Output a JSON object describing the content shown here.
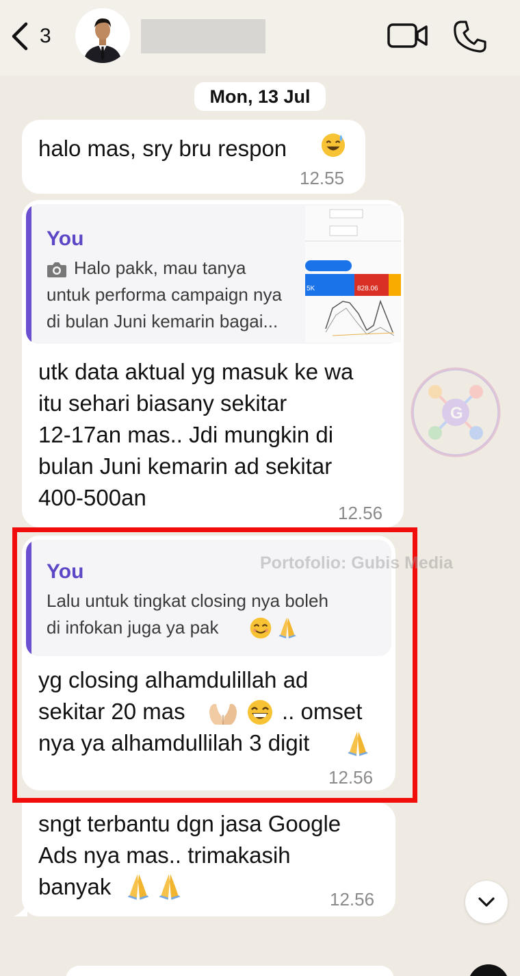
{
  "header": {
    "back_count": "3",
    "contact_name": ""
  },
  "date_label": "Mon, 13 Jul",
  "messages": [
    {
      "text": "halo mas, sry bru respon",
      "emoji": "sweat-smile",
      "time": "12.55"
    },
    {
      "quote": {
        "author": "You",
        "line1": "Halo pakk, mau tanya",
        "line2": "untuk performa campaign nya",
        "line3": "di bulan Juni kemarin bagai...",
        "thumb_values": [
          "5K",
          "828.06"
        ]
      },
      "lines": [
        "utk data aktual yg masuk ke wa",
        "itu sehari biasany sekitar",
        "12-17an mas.. Jdi mungkin di",
        "bulan Juni kemarin ad sekitar",
        "400-500an"
      ],
      "time": "12.56"
    },
    {
      "quote": {
        "author": "You",
        "line1": "Lalu untuk tingkat closing nya boleh",
        "line2": "di infokan juga ya pak"
      },
      "lines": [
        "yg closing alhamdulillah ad",
        "sekitar 20 mas",
        ".. omset",
        "nya ya alhamdullilah 3 digit"
      ],
      "time": "12.56"
    },
    {
      "lines": [
        "sngt terbantu dgn jasa Google",
        "Ads nya mas.. trimakasih",
        "banyak"
      ],
      "time": "12.56"
    }
  ],
  "watermark": "Portofolio: Gubis Media",
  "colors": {
    "background": "#efeae2",
    "bubble": "#ffffff",
    "quote_accent": "#6b4fd1",
    "highlight": "#f20d0d"
  }
}
